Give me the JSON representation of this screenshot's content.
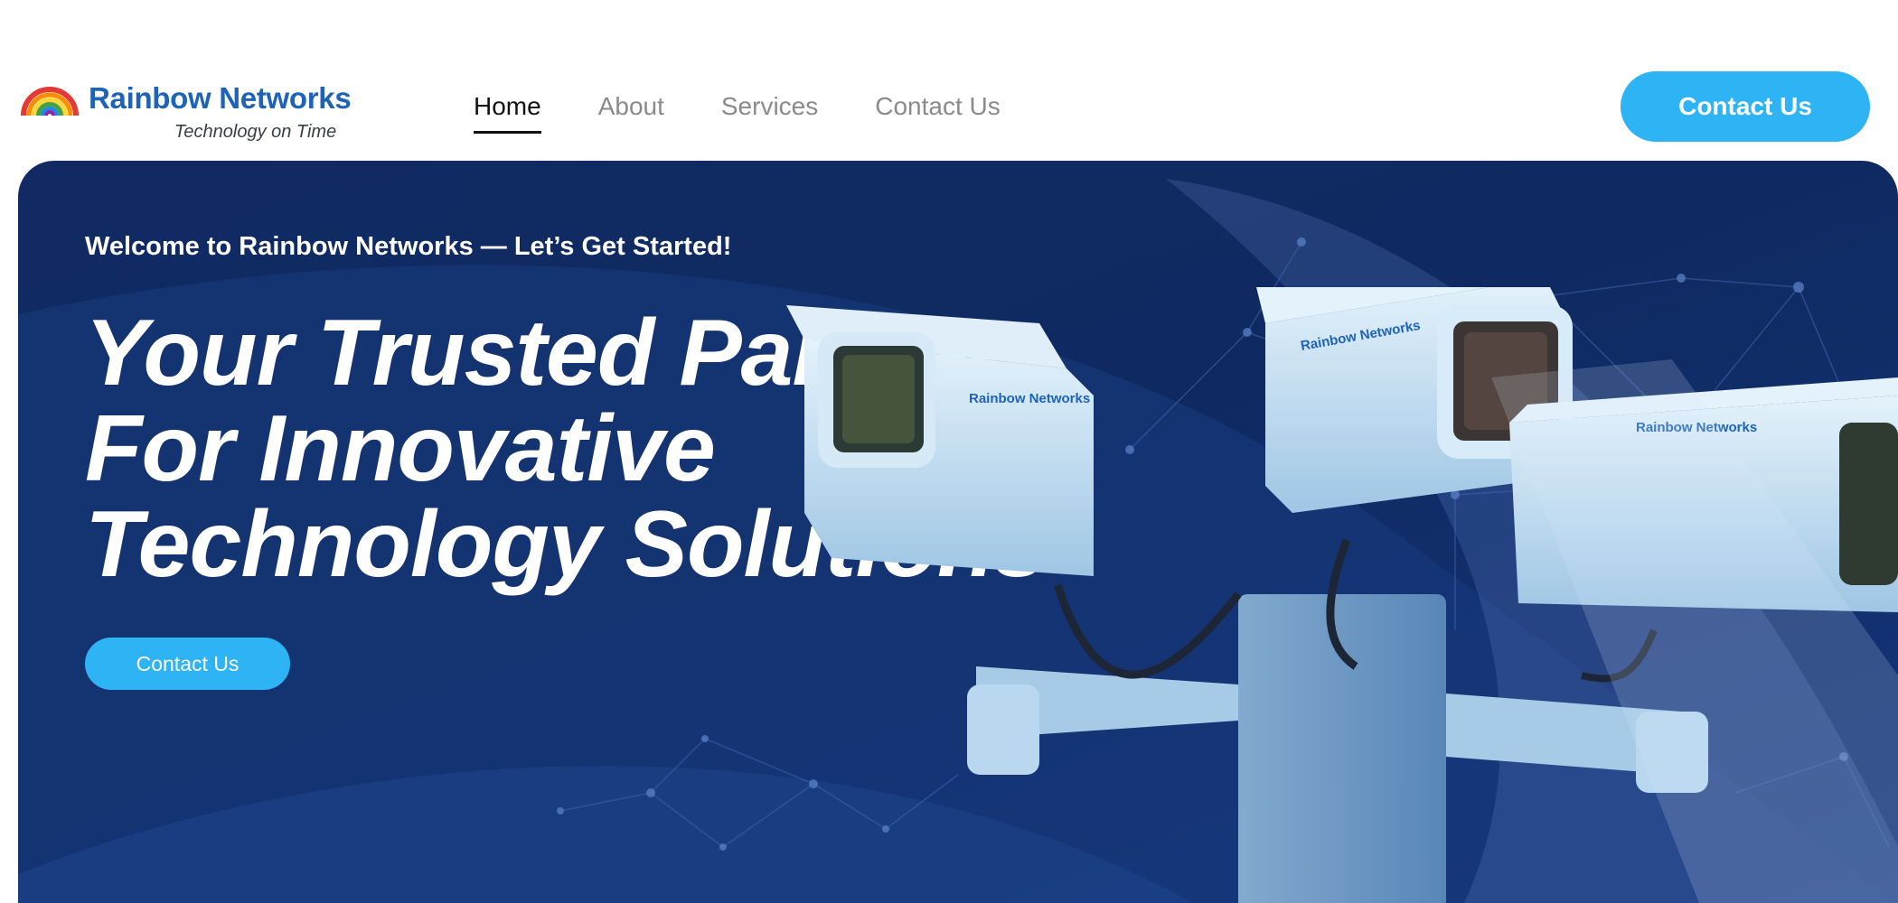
{
  "brand": {
    "name": "Rainbow Networks",
    "tagline": "Technology on Time"
  },
  "nav": {
    "items": [
      {
        "label": "Home",
        "active": true
      },
      {
        "label": "About",
        "active": false
      },
      {
        "label": "Services",
        "active": false
      },
      {
        "label": "Contact Us",
        "active": false
      }
    ]
  },
  "header": {
    "cta_label": "Contact Us"
  },
  "hero": {
    "welcome": "Welcome to Rainbow Networks — Let’s Get Started!",
    "headline_lines": [
      "Your Trusted Partner",
      "For Innovative",
      "Technology Solutions"
    ],
    "cta_label": "Contact Us",
    "camera_brand": "Rainbow Networks"
  },
  "colors": {
    "accent": "#2eb3f5",
    "brand_blue": "#1e63b8",
    "hero_bg": "#112a63"
  },
  "icons": [
    "rainbow-logo-icon",
    "security-camera-icon"
  ]
}
